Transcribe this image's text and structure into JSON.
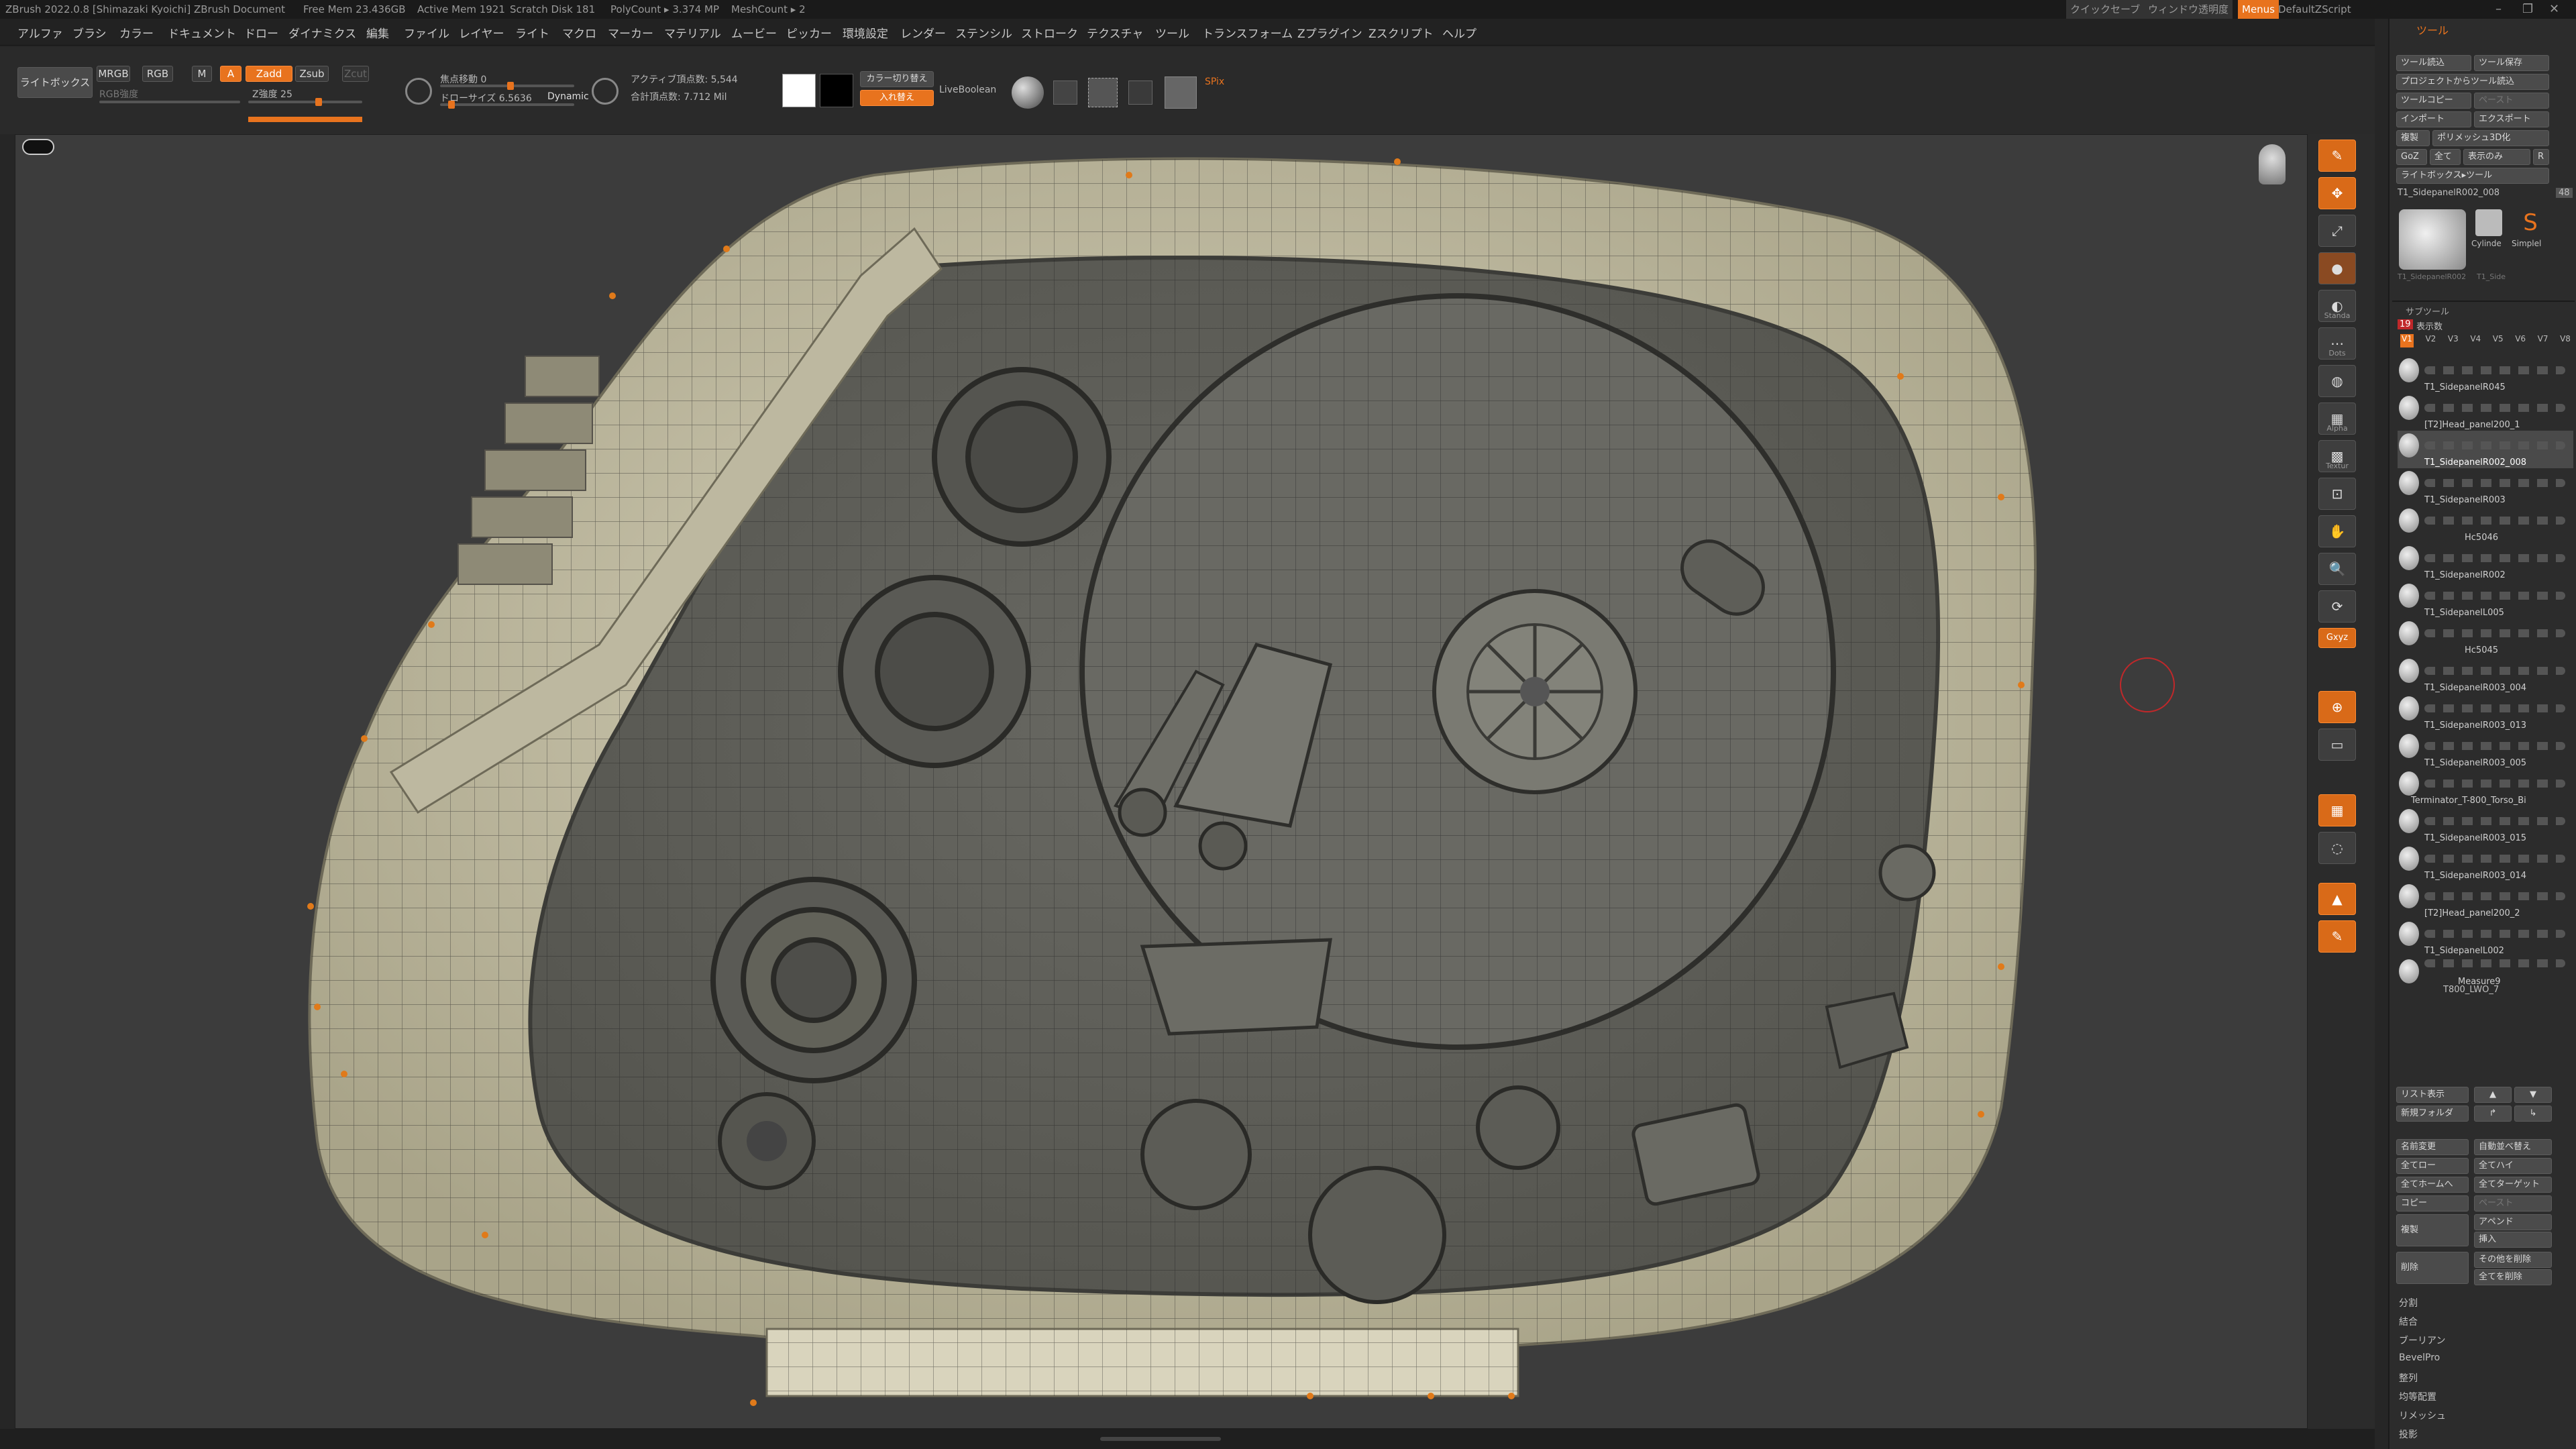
{
  "titlebar": {
    "app": "ZBrush 2022.0.8 [Shimazaki Kyoichi]  ZBrush Document",
    "free_mem": "Free Mem 23.436GB",
    "active_mem": "Active Mem 1921",
    "scratch": "Scratch Disk 181",
    "polycount": "PolyCount ▸ 3.374 MP",
    "meshcount": "MeshCount ▸ 2",
    "quicksave": "クイックセーブ",
    "transparency": "ウィンドウ透明度",
    "menus": "Menus",
    "script": "DefaultZScript"
  },
  "menu": [
    "アルファ",
    "ブラシ",
    "カラー",
    "ドキュメント",
    "ドロー",
    "ダイナミクス",
    "編集",
    "ファイル",
    "レイヤー",
    "ライト",
    "マクロ",
    "マーカー",
    "マテリアル",
    "ムービー",
    "ピッカー",
    "環境設定",
    "レンダー",
    "ステンシル",
    "ストローク",
    "テクスチャ",
    "ツール",
    "トランスフォーム",
    "Zプラグイン",
    "Zスクリプト",
    "ヘルプ"
  ],
  "toolbar": {
    "lightbox": "ライトボックス",
    "mrgb": "MRGB",
    "rgb": "RGB",
    "m": "M",
    "a": "A",
    "zadd": "Zadd",
    "zsub": "Zsub",
    "zcut": "Zcut",
    "rgb_intensity": "RGB強度",
    "z_intensity": "Z強度 25",
    "focal": "焦点移動 0",
    "draw_size": "ドローサイズ 6.5636",
    "dynamic": "Dynamic",
    "active_points": "アクティブ頂点数: 5,544",
    "total_points": "合計頂点数: 7.712 Mil",
    "color_switch": "カラー切り替え",
    "swap": "入れ替え",
    "liveboolean": "LiveBoolean",
    "spix": "SPix"
  },
  "right_shelf": [
    {
      "icon": "edit-icon",
      "label": "Edit",
      "orange": true
    },
    {
      "icon": "move-icon",
      "label": "移動",
      "orange": true
    },
    {
      "icon": "scale-icon",
      "label": "拡大"
    },
    {
      "icon": "brush-icon",
      "label": ""
    },
    {
      "icon": "standard-icon",
      "label": "Standa"
    },
    {
      "icon": "stroke-icon",
      "label": "Dots"
    },
    {
      "icon": "mrgb-icon",
      "label": "MRGBZ"
    },
    {
      "icon": "alpha-icon",
      "label": "Alpha"
    },
    {
      "icon": "texture-icon",
      "label": "Textur"
    },
    {
      "icon": "frame-icon",
      "label": "フレーム"
    },
    {
      "icon": "move-view-icon",
      "label": "移動"
    },
    {
      "icon": "zoom-icon",
      "label": "ズーム"
    },
    {
      "icon": "rotate-icon",
      "label": "回転"
    },
    {
      "icon": "xyz-icon",
      "label": "Gxyz",
      "orange": true
    },
    {
      "icon": "local-icon",
      "label": "ローカル",
      "orange": true
    },
    {
      "icon": "floor-icon",
      "label": "Floor"
    },
    {
      "icon": "polyf-icon",
      "label": "PolyF",
      "orange": true
    },
    {
      "icon": "transp-icon",
      "label": "透明"
    },
    {
      "icon": "solo-icon",
      "label": "ソロ",
      "orange": true
    },
    {
      "icon": "ghost-icon",
      "label": "ゴースト",
      "orange": true
    }
  ],
  "tool_panel": {
    "title": "ツール",
    "load": "ツール読込",
    "save": "ツール保存",
    "from_project": "プロジェクトからツール読込",
    "copy": "ツールコピー",
    "paste": "ペースト",
    "import": "インポート",
    "export": "エクスポート",
    "clone": "複製",
    "poly3d": "ポリメッシュ3D化",
    "goz": "GoZ",
    "all": "全て",
    "visible": "表示のみ",
    "r": "R",
    "lightbox_tool": "ライトボックス▸ツール",
    "current_tool": "T1_SidepanelR002_008",
    "tool_count": "48",
    "thumbs": [
      "T1_SidepanelR002",
      "Cylinde",
      "Simplel",
      "T1_Side"
    ],
    "subtool_title": "サブツール",
    "visible_count": "表示数",
    "versions": [
      "V1",
      "V2",
      "V3",
      "V4",
      "V5",
      "V6",
      "V7",
      "V8"
    ],
    "subtools": [
      "T1_SidepanelR045",
      "[T2]Head_panel200_1",
      "T1_SidepanelR002_008",
      "T1_SidepanelR003",
      "Hc5046",
      "T1_SidepanelR002",
      "T1_SidepanelL005",
      "Hc5045",
      "T1_SidepanelR003_004",
      "T1_SidepanelR003_013",
      "T1_SidepanelR003_005",
      "Terminator_T-800_Torso_Bi",
      "T1_SidepanelR003_015",
      "T1_SidepanelR003_014",
      "[T2]Head_panel200_2",
      "T1_SidepanelL002",
      "Measure9",
      "T800_LWO_7"
    ],
    "list_all": "リスト表示",
    "new_folder": "新規フォルダ",
    "rename": "名前変更",
    "auto_reorder": "自動並べ替え",
    "all_low": "全てロー",
    "all_high": "全てハイ",
    "all_home": "全てホームへ",
    "all_target": "全てターゲット",
    "copy_btn": "コピー",
    "paste_btn": "ペースト",
    "duplicate": "複製",
    "append": "アペンド",
    "insert": "挿入",
    "delete": "削除",
    "delete_other": "その他を削除",
    "delete_all": "全てを削除",
    "sections": [
      "分割",
      "結合",
      "ブーリアン",
      "BevelPro",
      "整列",
      "均等配置",
      "リメッシュ",
      "投影"
    ]
  }
}
